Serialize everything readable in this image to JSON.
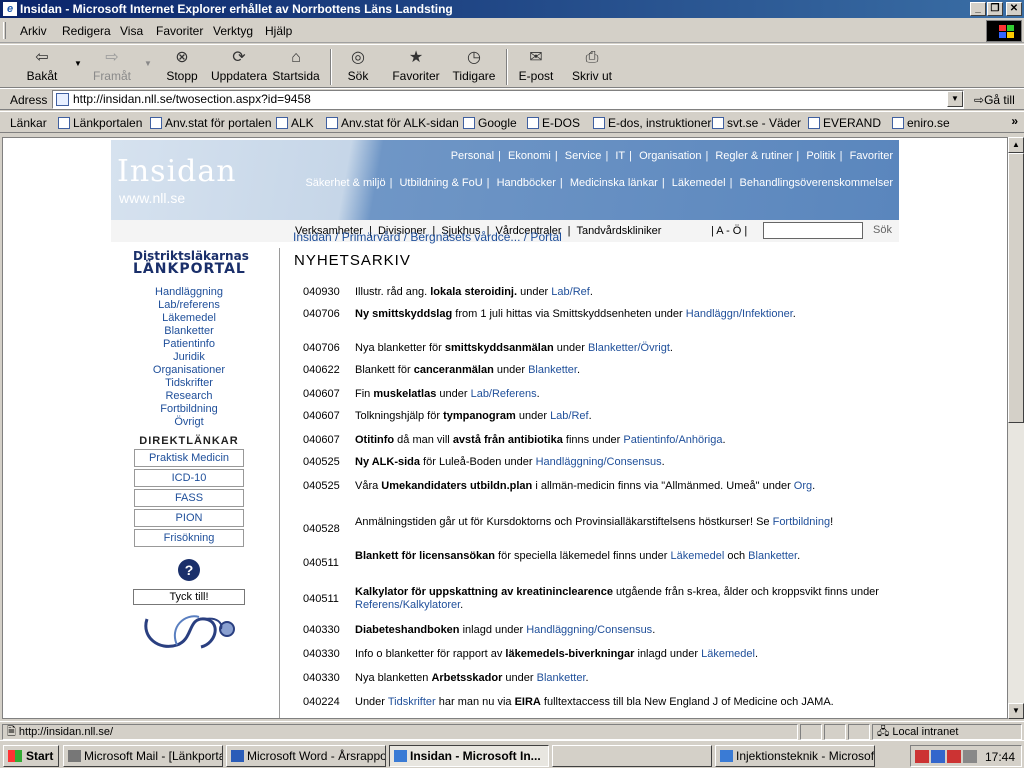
{
  "window": {
    "title": "Insidan - Microsoft Internet Explorer erhållet av Norrbottens Läns Landsting"
  },
  "menu": [
    "Arkiv",
    "Redigera",
    "Visa",
    "Favoriter",
    "Verktyg",
    "Hjälp"
  ],
  "toolbar": {
    "back": "Bakåt",
    "forward": "Framåt",
    "stop": "Stopp",
    "refresh": "Uppdatera",
    "home": "Startsida",
    "search": "Sök",
    "favorites": "Favoriter",
    "history": "Tidigare",
    "mail": "E-post",
    "print": "Skriv ut"
  },
  "address": {
    "label": "Adress",
    "url": "http://insidan.nll.se/twosection.aspx?id=9458",
    "go": "Gå till"
  },
  "links": {
    "label": "Länkar",
    "items": [
      "Länkportalen",
      "Anv.stat för portalen",
      "ALK",
      "Anv.stat för ALK-sidan",
      "Google",
      "E-DOS",
      "E-dos, instruktioner",
      "svt.se - Väder",
      "EVERAND",
      "eniro.se"
    ]
  },
  "site": {
    "logo": "Insidan",
    "logo_sub": "www.nll.se",
    "nav1": [
      "Personal",
      "|",
      "Ekonomi",
      "|",
      "Service",
      "|",
      "IT",
      "|",
      "Organisation",
      "|",
      "Regler & rutiner",
      "|",
      "Politik",
      "|",
      "Favoriter"
    ],
    "nav2": [
      "Säkerhet & miljö",
      "|",
      "Utbildning & FoU",
      "|",
      "Handböcker",
      "|",
      "Medicinska länkar",
      "|",
      "Läkemedel",
      "|",
      "Behandlingsöverenskommelser"
    ],
    "nav3": "Verksamheter  |  Divisioner  |  Sjukhus  |  Vårdcentraler  |  Tandvårdskliniker",
    "az": "| A - Ö |",
    "search_btn": "Sök"
  },
  "breadcrumb": "Insidan / Primärvård / Bergnäsets vårdce... / Portal",
  "heading": "NYHETSARKIV",
  "sidebar": {
    "logo_line1": "Distriktsläkarnas",
    "logo_line2": "LÄNKPORTAL",
    "links": [
      "Handläggning",
      "Lab/referens",
      "Läkemedel",
      "Blanketter",
      "Patientinfo",
      "Juridik",
      "Organisationer",
      "Tidskrifter",
      "Research",
      "Fortbildning",
      "Övrigt"
    ],
    "direct_title": "DIREKTLÄNKAR",
    "direct": [
      "Praktisk Medicin",
      "ICD-10",
      "FASS",
      "PION",
      "Frisökning"
    ],
    "help": "?",
    "feedback": "Tyck till!"
  },
  "news": [
    {
      "date": "040930",
      "parts": [
        [
          "",
          "Illustr. råd ang. "
        ],
        [
          "b",
          "lokala steroidinj."
        ],
        [
          "",
          " under "
        ],
        [
          "a",
          "Lab/Ref"
        ],
        [
          "",
          "."
        ]
      ]
    },
    {
      "date": "040706",
      "parts": [
        [
          "b",
          "Ny smittskyddslag"
        ],
        [
          "",
          " from 1 juli hittas via Smittskyddsenheten under "
        ],
        [
          "a",
          "Handläggn/Infektioner"
        ],
        [
          "",
          "."
        ]
      ]
    },
    {
      "date": "040706",
      "parts": [
        [
          "",
          "Nya blanketter för "
        ],
        [
          "b",
          "smittskyddsanmälan"
        ],
        [
          "",
          " under "
        ],
        [
          "a",
          "Blanketter/Övrigt"
        ],
        [
          "",
          "."
        ]
      ]
    },
    {
      "date": "040622",
      "parts": [
        [
          "",
          "Blankett för "
        ],
        [
          "b",
          "canceranmälan"
        ],
        [
          "",
          " under "
        ],
        [
          "a",
          "Blanketter"
        ],
        [
          "",
          "."
        ]
      ]
    },
    {
      "date": "040607",
      "parts": [
        [
          "",
          "Fin "
        ],
        [
          "b",
          "muskelatlas"
        ],
        [
          "",
          " under "
        ],
        [
          "a",
          "Lab/Referens"
        ],
        [
          "",
          "."
        ]
      ]
    },
    {
      "date": "040607",
      "parts": [
        [
          "",
          "Tolkningshjälp för "
        ],
        [
          "b",
          "tympanogram"
        ],
        [
          "",
          " under "
        ],
        [
          "a",
          "Lab/Ref"
        ],
        [
          "",
          "."
        ]
      ]
    },
    {
      "date": "040607",
      "parts": [
        [
          "b",
          "Otitinfo"
        ],
        [
          "",
          " då man vill "
        ],
        [
          "b",
          "avstå från antibiotika"
        ],
        [
          "",
          " finns under "
        ],
        [
          "a",
          "Patientinfo/Anhöriga"
        ],
        [
          "",
          "."
        ]
      ]
    },
    {
      "date": "040525",
      "parts": [
        [
          "b",
          "Ny ALK-sida"
        ],
        [
          "",
          " för Luleå-Boden under "
        ],
        [
          "a",
          "Handläggning/Consensus"
        ],
        [
          "",
          "."
        ]
      ]
    },
    {
      "date": "040525",
      "parts": [
        [
          "",
          "Våra "
        ],
        [
          "b",
          "Umekandidaters utbildn.plan"
        ],
        [
          "",
          " i allmän-medicin finns via \"Allmänmed. Umeå\" under "
        ],
        [
          "a",
          "Org"
        ],
        [
          "",
          "."
        ]
      ]
    },
    {
      "date": "040528",
      "parts": [
        [
          "",
          "Anmälningstiden går ut för Kursdoktorns och Provinsialläkarstiftelsens höstkurser! Se "
        ],
        [
          "a",
          "Fortbildning"
        ],
        [
          "",
          "!"
        ]
      ]
    },
    {
      "date": "040511",
      "parts": [
        [
          "b",
          "Blankett för licensansökan"
        ],
        [
          "",
          " för speciella läkemedel finns under "
        ],
        [
          "a",
          "Läkemedel"
        ],
        [
          "",
          " och "
        ],
        [
          "a",
          "Blanketter"
        ],
        [
          "",
          "."
        ]
      ]
    },
    {
      "date": "040511",
      "parts": [
        [
          "b",
          "Kalkylator för uppskattning av kreatininclearence"
        ],
        [
          "",
          " utgående från s-krea, ålder och kroppsvikt finns under "
        ],
        [
          "a",
          "Referens/Kalkylatorer"
        ],
        [
          "",
          "."
        ]
      ]
    },
    {
      "date": "040330",
      "parts": [
        [
          "b",
          "Diabeteshandboken"
        ],
        [
          "",
          " inlagd under "
        ],
        [
          "a",
          "Handläggning/Consensus"
        ],
        [
          "",
          "."
        ]
      ]
    },
    {
      "date": "040330",
      "parts": [
        [
          "",
          "Info o blanketter för rapport av "
        ],
        [
          "b",
          "läkemedels-biverkningar"
        ],
        [
          "",
          " inlagd under "
        ],
        [
          "a",
          "Läkemedel"
        ],
        [
          "",
          "."
        ]
      ]
    },
    {
      "date": "040330",
      "parts": [
        [
          "",
          "Nya blanketten "
        ],
        [
          "b",
          "Arbetsskador"
        ],
        [
          "",
          " under "
        ],
        [
          "a",
          "Blanketter"
        ],
        [
          "",
          "."
        ]
      ]
    },
    {
      "date": "040224",
      "parts": [
        [
          "",
          "Under "
        ],
        [
          "a",
          "Tidskrifter"
        ],
        [
          "",
          " har man nu via "
        ],
        [
          "b",
          "EIRA"
        ],
        [
          "",
          " fulltextaccess till bla New England J of Medicine och JAMA."
        ]
      ]
    }
  ],
  "status": {
    "url": "http://insidan.nll.se/",
    "zone": "Local intranet"
  },
  "taskbar": {
    "start": "Start",
    "tasks": [
      "Microsoft Mail - [Länkportal...",
      "Microsoft Word - Årsrappor...",
      "Insidan - Microsoft In...",
      "",
      "Injektionsteknik - Microsoft..."
    ],
    "clock": "17:44"
  }
}
